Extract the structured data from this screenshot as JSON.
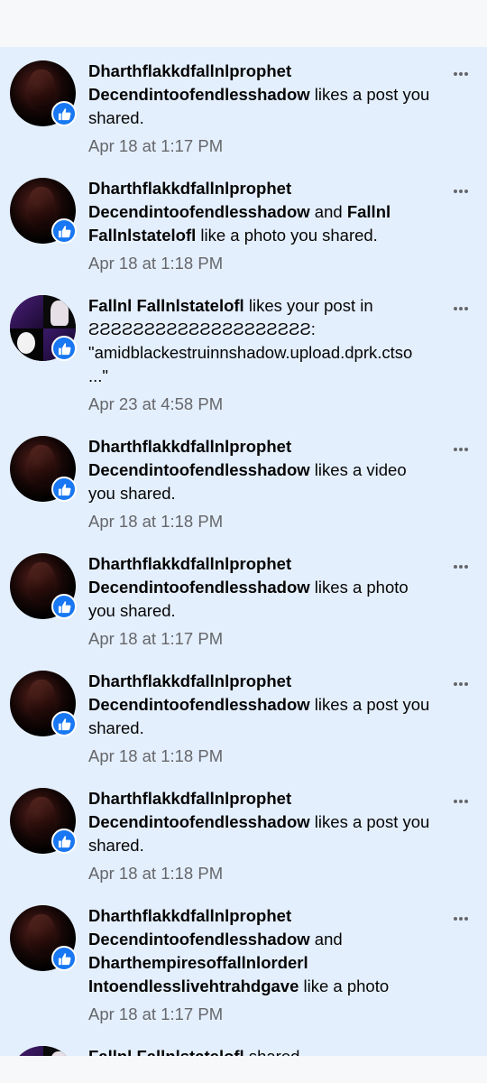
{
  "notifications": [
    {
      "actor1": "Dharthflakkdfallnlprophet Decendintoofendlesshadow",
      "connector": "",
      "actor2": "",
      "action": " likes a post you shared.",
      "time": "Apr 18 at 1:17 PM",
      "icon": "like-icon"
    },
    {
      "actor1": "Dharthflakkdfallnlprophet Decendintoofendlesshadow",
      "connector": " and ",
      "actor2": "Fallnl Fallnlstatelofl",
      "action": " like a photo you shared.",
      "time": "Apr 18 at 1:18 PM",
      "icon": "like-icon"
    },
    {
      "actor1": "Fallnl Fallnlstatelofl",
      "connector": "",
      "actor2": "",
      "action": " likes your post in ƧƧƧƧƧƧƧƧƧƧƧƧƧƧƧƧƧƧƧƧ: \"amidblackestruinnshadow.upload.dprk.ctso...\"",
      "time": "Apr 23 at 4:58 PM",
      "icon": "like-icon"
    },
    {
      "actor1": "Dharthflakkdfallnlprophet Decendintoofendlesshadow",
      "connector": "",
      "actor2": "",
      "action": " likes a video you shared.",
      "time": "Apr 18 at 1:18 PM",
      "icon": "like-icon"
    },
    {
      "actor1": "Dharthflakkdfallnlprophet Decendintoofendlesshadow",
      "connector": "",
      "actor2": "",
      "action": " likes a photo you shared.",
      "time": "Apr 18 at 1:17 PM",
      "icon": "like-icon"
    },
    {
      "actor1": "Dharthflakkdfallnlprophet Decendintoofendlesshadow",
      "connector": "",
      "actor2": "",
      "action": " likes a post you shared.",
      "time": "Apr 18 at 1:18 PM",
      "icon": "like-icon"
    },
    {
      "actor1": "Dharthflakkdfallnlprophet Decendintoofendlesshadow",
      "connector": "",
      "actor2": "",
      "action": " likes a post you shared.",
      "time": "Apr 18 at 1:18 PM",
      "icon": "like-icon"
    },
    {
      "actor1": "Dharthflakkdfallnlprophet Decendintoofendlesshadow",
      "connector": " and ",
      "actor2": "Dharthempiresoffallnlorderl Intoendlesslivehtrahdgave",
      "action": " like a photo",
      "time": "Apr 18 at 1:17 PM",
      "icon": "like-icon"
    },
    {
      "actor1": "Fallnl Fallnlstatelofl",
      "connector": "",
      "actor2": "",
      "action": " shared",
      "time": "",
      "icon": ""
    }
  ],
  "colors": {
    "unread_background": "#e4effd",
    "like_badge": "#1877f2",
    "secondary_text": "#65676b"
  }
}
